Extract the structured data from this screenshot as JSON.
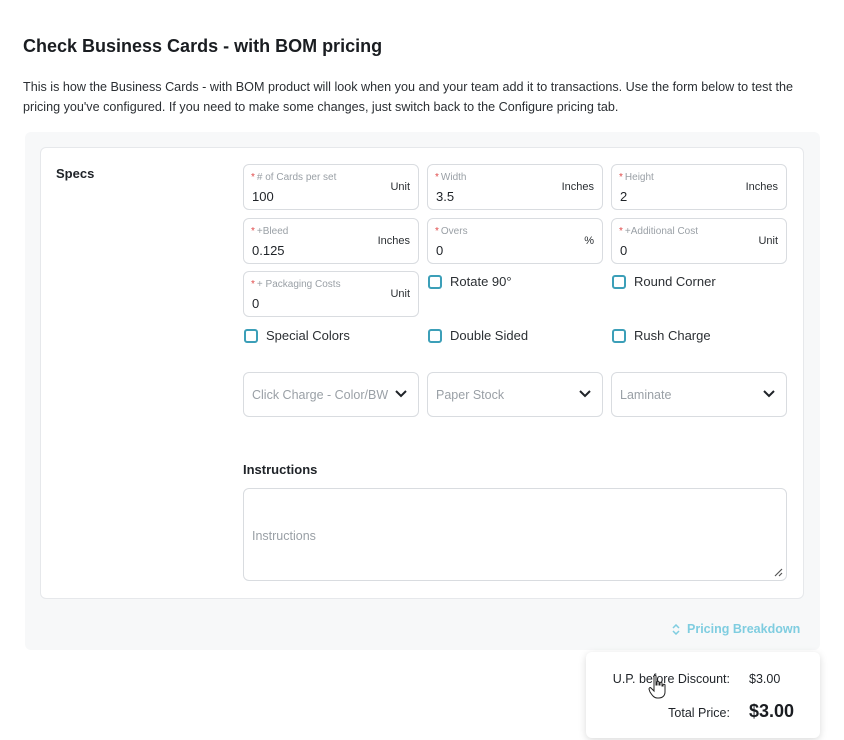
{
  "page": {
    "title": "Check Business Cards - with BOM pricing",
    "description": "This is how the Business Cards - with BOM product will look when you and your team add it to transactions. Use the form below to test the pricing you've configured. If you need to make some changes, just switch back to the Configure pricing tab."
  },
  "specs": {
    "label": "Specs",
    "fields": {
      "cards_per_set": {
        "label": "# of Cards per set",
        "value": "100",
        "unit": "Unit"
      },
      "width": {
        "label": "Width",
        "value": "3.5",
        "unit": "Inches"
      },
      "height": {
        "label": "Height",
        "value": "2",
        "unit": "Inches"
      },
      "bleed": {
        "label": "+Bleed",
        "value": "0.125",
        "unit": "Inches"
      },
      "overs": {
        "label": "Overs",
        "value": "0",
        "unit": "%"
      },
      "additional_cost": {
        "label": "+Additional Cost",
        "value": "0",
        "unit": "Unit"
      },
      "packaging_costs": {
        "label": "+ Packaging Costs",
        "value": "0",
        "unit": "Unit"
      }
    },
    "required_marker": "*",
    "checkboxes": {
      "rotate": "Rotate 90°",
      "round_corner": "Round Corner",
      "special_colors": "Special Colors",
      "double_sided": "Double Sided",
      "rush_charge": "Rush Charge"
    },
    "selects": {
      "click_charge": "Click Charge - Color/BW",
      "paper_stock": "Paper Stock",
      "laminate": "Laminate"
    }
  },
  "instructions": {
    "label": "Instructions",
    "placeholder": "Instructions"
  },
  "pricing": {
    "breakdown_label": "Pricing Breakdown",
    "up_before_discount_label": "U.P. before Discount:",
    "up_before_discount_value": "$3.00",
    "total_label": "Total Price:",
    "total_value": "$3.00"
  },
  "colors": {
    "accent": "#3c9fb8",
    "breakdown_link": "#7fcde0",
    "required": "#e04b4b"
  }
}
